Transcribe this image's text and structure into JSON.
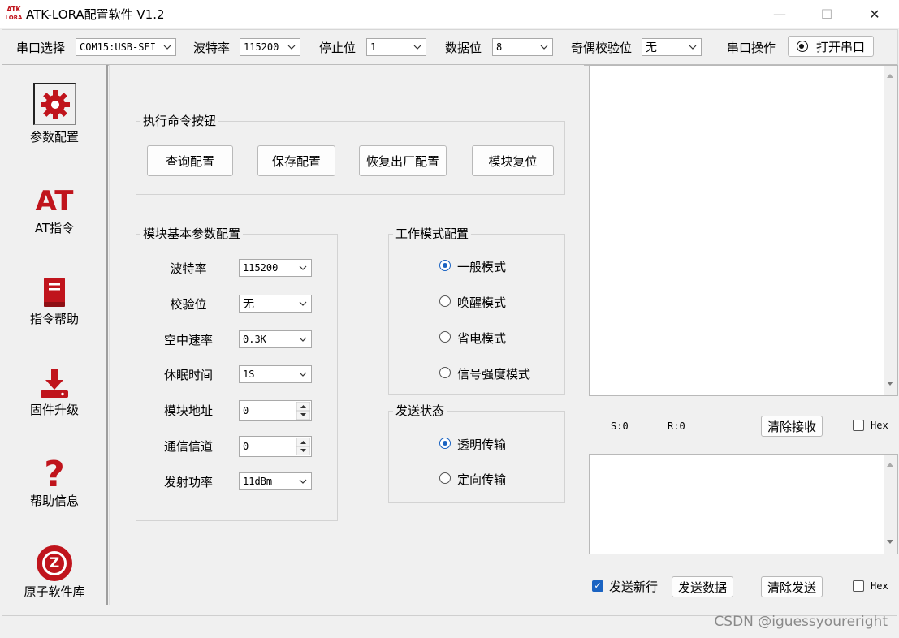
{
  "window": {
    "title": "ATK-LORA配置软件 V1.2",
    "logo_text_top": "ATK",
    "logo_text_bottom": "LORA",
    "minimize": "—",
    "maximize": "☐",
    "close": "✕"
  },
  "toolbar": {
    "port_label": "串口选择",
    "port_value": "COM15:USB-SEI",
    "baud_label": "波特率",
    "baud_value": "115200",
    "stop_label": "停止位",
    "stop_value": "1",
    "data_label": "数据位",
    "data_value": "8",
    "parity_label": "奇偶校验位",
    "parity_value": "无",
    "serial_op_label": "串口操作",
    "open_port_button": "打开串口"
  },
  "nav": {
    "items": [
      {
        "label": "参数配置",
        "icon": "gear-icon"
      },
      {
        "label": "AT指令",
        "icon": "at-icon",
        "icon_text": "AT"
      },
      {
        "label": "指令帮助",
        "icon": "book-icon"
      },
      {
        "label": "固件升级",
        "icon": "download-icon"
      },
      {
        "label": "帮助信息",
        "icon": "question-icon",
        "icon_text": "?"
      },
      {
        "label": "原子软件库",
        "icon": "z-logo-icon",
        "icon_text": "Z"
      }
    ],
    "accent_color": "#c0141c"
  },
  "commands": {
    "title": "执行命令按钮",
    "query": "查询配置",
    "save": "保存配置",
    "restore": "恢复出厂配置",
    "reset": "模块复位"
  },
  "params": {
    "title": "模块基本参数配置",
    "rows": [
      {
        "label": "波特率",
        "value": "115200",
        "type": "combo"
      },
      {
        "label": "校验位",
        "value": "无",
        "type": "combo"
      },
      {
        "label": "空中速率",
        "value": "0.3K",
        "type": "combo"
      },
      {
        "label": "休眠时间",
        "value": "1S",
        "type": "combo"
      },
      {
        "label": "模块地址",
        "value": "0",
        "type": "spin"
      },
      {
        "label": "通信信道",
        "value": "0",
        "type": "spin"
      },
      {
        "label": "发射功率",
        "value": "11dBm",
        "type": "combo"
      }
    ]
  },
  "work_mode": {
    "title": "工作模式配置",
    "options": [
      "一般模式",
      "唤醒模式",
      "省电模式",
      "信号强度模式"
    ],
    "selected": 0
  },
  "send_state": {
    "title": "发送状态",
    "options": [
      "透明传输",
      "定向传输"
    ],
    "selected": 0
  },
  "receive": {
    "s_count": "S:0",
    "r_count": "R:0",
    "clear_button": "清除接收",
    "hex_label": "Hex"
  },
  "send": {
    "newline_label": "发送新行",
    "newline_checked": true,
    "send_button": "发送数据",
    "clear_button": "清除发送",
    "hex_label": "Hex"
  },
  "watermark": "CSDN @iguessyoureright"
}
